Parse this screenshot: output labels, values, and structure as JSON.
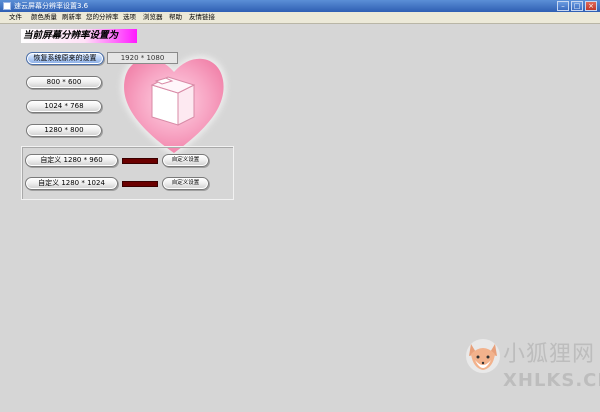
{
  "window": {
    "title": "速云屏幕分辨率设置3.6",
    "min_glyph": "–",
    "max_glyph": "□",
    "close_glyph": "×"
  },
  "menu": [
    "文件",
    "颜色质量",
    "刷新率",
    "您的分辨率",
    "选项",
    "浏览器",
    "帮助",
    "友情链接"
  ],
  "heading": "当前屏幕分辨率设置为",
  "current_resolution": "1920 * 1080",
  "restore_button": "恢复系统原来的设置",
  "preset_buttons": [
    "800 * 600",
    "1024 * 768",
    "1280 * 800"
  ],
  "custom": [
    {
      "label": "自定义 1280 * 960",
      "set_label": "自定义设置"
    },
    {
      "label": "自定义 1280 * 1024",
      "set_label": "自定义设置"
    }
  ],
  "watermark": {
    "line1": "小狐狸网",
    "line2": "XHLKS.CN"
  },
  "colors": {
    "accent_magenta": "#ff18ff",
    "bar": "#6b0000",
    "heart": "#f59ab8"
  },
  "icons": {
    "heart": "heart-folder-graphic",
    "fox": "fox-logo"
  }
}
